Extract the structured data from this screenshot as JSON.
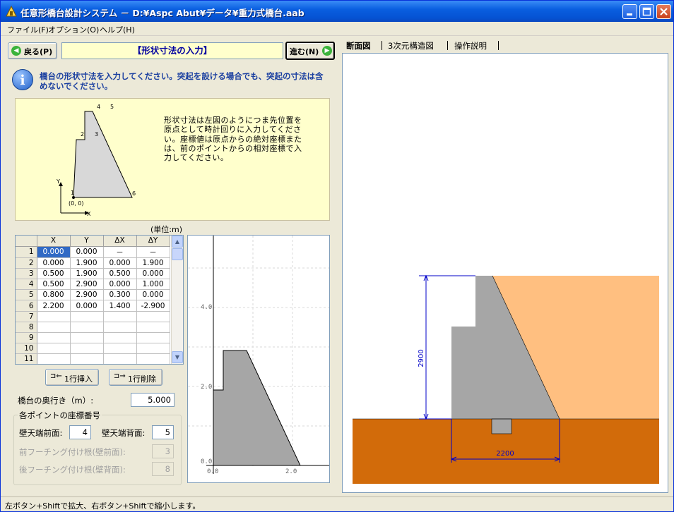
{
  "window": {
    "title": "任意形橋台設計システム － D:¥Aspc Abut¥データ¥重力式橋台.aab"
  },
  "menu": [
    "ファイル(F)",
    "オプション(O)",
    "ヘルプ(H)"
  ],
  "nav": {
    "back_label": "戻る(P)",
    "forward_label": "進む(N)",
    "step_title": "【形状寸法の入力】"
  },
  "instruction": "橋台の形状寸法を入力してください。突起を設ける場合でも、突起の寸法は含めないでください。",
  "diagram": {
    "description": "形状寸法は左図のようにつま先位置を原点として時計回りに入力してください。座標値は原点からの絶対座標または、前のポイントからの相対座標で入力してください。",
    "point_labels": [
      "1",
      "2",
      "3",
      "4",
      "5",
      "6"
    ],
    "origin_label": "(0, 0)",
    "x_axis": "X",
    "y_axis": "Y"
  },
  "grid": {
    "unit_label": "(単位:m)",
    "columns": [
      "X",
      "Y",
      "ΔX",
      "ΔY"
    ],
    "rows": [
      {
        "no": "1",
        "cells": [
          "0.000",
          "0.000",
          "－",
          "－"
        ]
      },
      {
        "no": "2",
        "cells": [
          "0.000",
          "1.900",
          "0.000",
          "1.900"
        ]
      },
      {
        "no": "3",
        "cells": [
          "0.500",
          "1.900",
          "0.500",
          "0.000"
        ]
      },
      {
        "no": "4",
        "cells": [
          "0.500",
          "2.900",
          "0.000",
          "1.000"
        ]
      },
      {
        "no": "5",
        "cells": [
          "0.800",
          "2.900",
          "0.300",
          "0.000"
        ]
      },
      {
        "no": "6",
        "cells": [
          "2.200",
          "0.000",
          "1.400",
          "-2.900"
        ]
      },
      {
        "no": "7",
        "cells": [
          "",
          "",
          "",
          ""
        ]
      },
      {
        "no": "8",
        "cells": [
          "",
          "",
          "",
          ""
        ]
      },
      {
        "no": "9",
        "cells": [
          "",
          "",
          "",
          ""
        ]
      },
      {
        "no": "10",
        "cells": [
          "",
          "",
          "",
          ""
        ]
      },
      {
        "no": "11",
        "cells": [
          "",
          "",
          "",
          ""
        ]
      }
    ]
  },
  "row_buttons": {
    "insert": "1行挿入",
    "delete": "1行削除"
  },
  "depth": {
    "label": "橋台の奥行き（m）:",
    "value": "5.000"
  },
  "coord_group": {
    "title": "各ポイントの座標番号",
    "wall_top_front_label": "壁天端前面:",
    "wall_top_front_value": "4",
    "wall_top_back_label": "壁天端背面:",
    "wall_top_back_value": "5",
    "front_footing_label": "前フーチング付け根(壁前面):",
    "front_footing_value": "3",
    "back_footing_label": "後フーチング付け根(壁背面):",
    "back_footing_value": "8"
  },
  "preview": {
    "y_ticks": [
      "4.0",
      "2.0",
      "0.0"
    ],
    "x_ticks": [
      "0.0",
      "2.0"
    ]
  },
  "tabs": [
    "断面図",
    "3次元構造図",
    "操作説明"
  ],
  "section": {
    "height_dim": "2900",
    "width_dim": "2200"
  },
  "colors": {
    "abutment": "#a6a6a6",
    "backfill": "#ffbf80",
    "ground": "#d26b0a",
    "dimension": "#0000c8"
  },
  "status": "左ボタン+Shiftで拡大、右ボタン+Shiftで縮小します。"
}
